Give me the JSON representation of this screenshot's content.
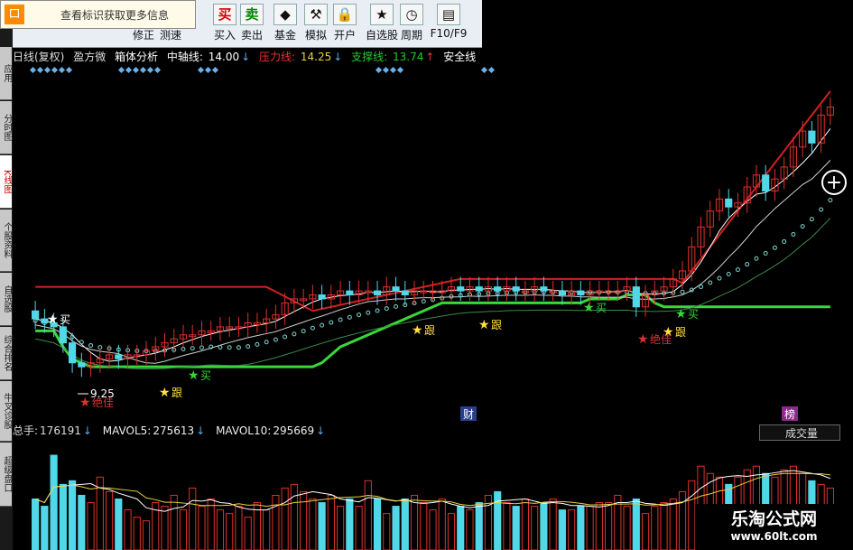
{
  "tooltip": {
    "text": "查看标识获取更多信息"
  },
  "toolbar": {
    "buttons": [
      {
        "label": "修正",
        "icon": "edit-icon",
        "glyph": "↓"
      },
      {
        "label": "测速",
        "icon": "speed-icon",
        "glyph": "⏱"
      },
      {
        "label": "买入",
        "icon": "buy-icon",
        "glyph": "买"
      },
      {
        "label": "卖出",
        "icon": "sell-icon",
        "glyph": "卖"
      },
      {
        "label": "基金",
        "icon": "fund-icon",
        "glyph": "◆"
      },
      {
        "label": "模拟",
        "icon": "gavel-icon",
        "glyph": "⚒"
      },
      {
        "label": "开户",
        "icon": "lock-icon",
        "glyph": "🔒"
      },
      {
        "label": "自选股",
        "icon": "star-folder-icon",
        "glyph": "★"
      },
      {
        "label": "周期",
        "icon": "clock-icon",
        "glyph": "◷"
      },
      {
        "label": "F10/F9",
        "icon": "f10-icon",
        "glyph": "▤"
      }
    ]
  },
  "sidebar": {
    "tabs": [
      "应用",
      "分时图",
      "K线图",
      "个股资料",
      "自选股",
      "综合排名",
      "牛叉诊股",
      "超级盘口"
    ]
  },
  "infobar": {
    "period": "日线(复权)",
    "indicator1": "盈方微",
    "indicator2": "箱体分析",
    "mid_label": "中轴线:",
    "mid_value": "14.00",
    "pressure_label": "压力线:",
    "pressure_value": "14.25",
    "support_label": "支撑线:",
    "support_value": "13.74",
    "safe_label": "安全线"
  },
  "chart_markers": {
    "buy": "买",
    "follow": "跟",
    "bottom": "绝佳",
    "low_price": "9.25",
    "cai": "财",
    "bang": "榜"
  },
  "volume": {
    "total_label": "总手:",
    "total_value": "176191",
    "mavol5_label": "MAVOL5:",
    "mavol5_value": "275613",
    "mavol10_label": "MAVOL10:",
    "mavol10_value": "295669",
    "selector": "成交量"
  },
  "watermark": {
    "title": "乐淘公式网",
    "url": "www.60lt.com"
  },
  "colors": {
    "up": "#e0302a",
    "down": "#50d8e8",
    "support": "#38d838",
    "pressure": "#d02020",
    "ma_white": "#ffffff",
    "ma_dots": "#7fd6d0",
    "ma_green": "#3a8a4a",
    "star_yellow": "#ffe040",
    "star_green": "#38d838"
  },
  "chart_data": {
    "type": "candlestick",
    "price_range": [
      8.5,
      16.5
    ],
    "low_marker": 9.25,
    "closes": [
      10.6,
      10.5,
      10.4,
      10.0,
      9.5,
      9.4,
      9.5,
      9.6,
      9.7,
      9.6,
      9.7,
      9.7,
      9.8,
      9.9,
      10.0,
      10.1,
      10.2,
      10.2,
      10.3,
      10.3,
      10.4,
      10.4,
      10.4,
      10.5,
      10.5,
      10.6,
      10.7,
      11.0,
      11.1,
      11.1,
      11.2,
      11.1,
      11.2,
      11.3,
      11.2,
      11.3,
      11.3,
      11.2,
      11.4,
      11.3,
      11.2,
      11.3,
      11.3,
      11.3,
      11.3,
      11.4,
      11.3,
      11.4,
      11.3,
      11.4,
      11.3,
      11.4,
      11.3,
      11.3,
      11.4,
      11.3,
      11.3,
      11.2,
      11.3,
      11.2,
      11.3,
      11.3,
      11.3,
      11.3,
      11.4,
      10.9,
      11.2,
      11.3,
      11.4,
      11.6,
      11.8,
      12.4,
      12.9,
      13.3,
      13.6,
      13.4,
      13.5,
      13.9,
      14.2,
      13.8,
      14.1,
      14.4,
      14.9,
      15.3,
      15.0,
      15.7,
      15.9
    ],
    "volumes": [
      140,
      120,
      260,
      180,
      190,
      150,
      130,
      200,
      160,
      140,
      110,
      90,
      80,
      130,
      120,
      150,
      110,
      170,
      120,
      140,
      110,
      100,
      120,
      90,
      130,
      110,
      150,
      170,
      180,
      160,
      140,
      130,
      150,
      120,
      140,
      120,
      190,
      140,
      100,
      120,
      140,
      150,
      130,
      110,
      140,
      100,
      120,
      110,
      130,
      150,
      160,
      130,
      120,
      140,
      120,
      130,
      140,
      110,
      110,
      120,
      120,
      130,
      130,
      150,
      120,
      140,
      100,
      120,
      130,
      140,
      160,
      190,
      230,
      210,
      200,
      180,
      200,
      220,
      230,
      210,
      200,
      220,
      230,
      210,
      190,
      180,
      170
    ]
  }
}
